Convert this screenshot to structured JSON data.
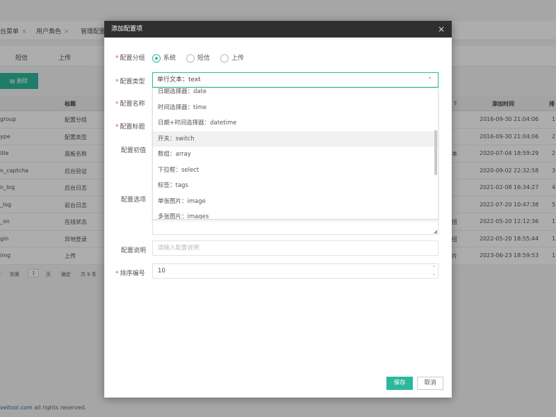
{
  "background": {
    "tabs": [
      {
        "label": "台菜单"
      },
      {
        "label": "用户角色"
      },
      {
        "label": "管理配置"
      }
    ],
    "subtabs": [
      {
        "label": "短信"
      },
      {
        "label": "上传"
      }
    ],
    "delete_label": "删除",
    "table": {
      "headers": {
        "title": "标题",
        "added_time": "添加时间",
        "sort": "排"
      },
      "rows": [
        {
          "name": "group",
          "title": "配置分组",
          "extra": "",
          "time": "2016-09-30 21:04:06",
          "num": "1"
        },
        {
          "name": "ype",
          "title": "配置类型",
          "extra": "",
          "time": "2016-09-30 21:04:06",
          "num": "2"
        },
        {
          "name": "itle",
          "title": "面板名称",
          "extra": "本",
          "time": "2020-07-04 18:59:29",
          "num": "2"
        },
        {
          "name": "n_captcha",
          "title": "后台验证",
          "extra": "",
          "time": "2020-09-02 22:32:58",
          "num": "3"
        },
        {
          "name": "n_log",
          "title": "后台日志",
          "extra": "",
          "time": "2021-02-08 16:34:27",
          "num": "4"
        },
        {
          "name": "_log",
          "title": "前台日志",
          "extra": "",
          "time": "2022-07-20 10:47:38",
          "num": "5"
        },
        {
          "name": "_on",
          "title": "在线状态",
          "extra": "扭",
          "time": "2022-05-20 12:12:36",
          "num": "1"
        },
        {
          "name": "gin",
          "title": "异地登录",
          "extra": "扭",
          "time": "2022-05-20 18:55:44",
          "num": "1"
        },
        {
          "name": "img",
          "title": "上传",
          "extra": "片",
          "time": "2023-06-23 18:59:53",
          "num": "1"
        }
      ]
    },
    "pager": {
      "goto": "到第",
      "page": "1",
      "unit": "页",
      "confirm": "确定",
      "total": "共 9 条"
    },
    "footer": {
      "link": "veitool.com",
      "text": " all rights reserved."
    }
  },
  "dialog": {
    "title": "添加配置项",
    "close_icon": "×",
    "fields": {
      "group": {
        "label": "配置分组",
        "required": "*",
        "options": [
          "系统",
          "短信",
          "上传"
        ],
        "selected": "系统"
      },
      "type": {
        "label": "配置类型",
        "required": "*",
        "value": "单行文本：text",
        "options": [
          "日期选择器：date",
          "时间选择器：time",
          "日期+时间选择器：datetime",
          "开关：switch",
          "数组：array",
          "下拉框：select",
          "标签：tags",
          "单张图片：image",
          "多张图片：images"
        ],
        "hovered": "开关：switch"
      },
      "name": {
        "label": "配置名称",
        "required": "*"
      },
      "title": {
        "label": "配置标题",
        "required": "*"
      },
      "initial": {
        "label": "配置初值"
      },
      "options_field": {
        "label": "配置选项"
      },
      "desc": {
        "label": "配置说明",
        "placeholder": "请输入配置说明"
      },
      "sort": {
        "label": "排序编号",
        "required": "*",
        "value": "10"
      }
    },
    "save_label": "保存",
    "cancel_label": "取消"
  },
  "colors": {
    "accent": "#2cb89a",
    "header_bg": "#2f2f2f",
    "required": "#ee4444"
  }
}
